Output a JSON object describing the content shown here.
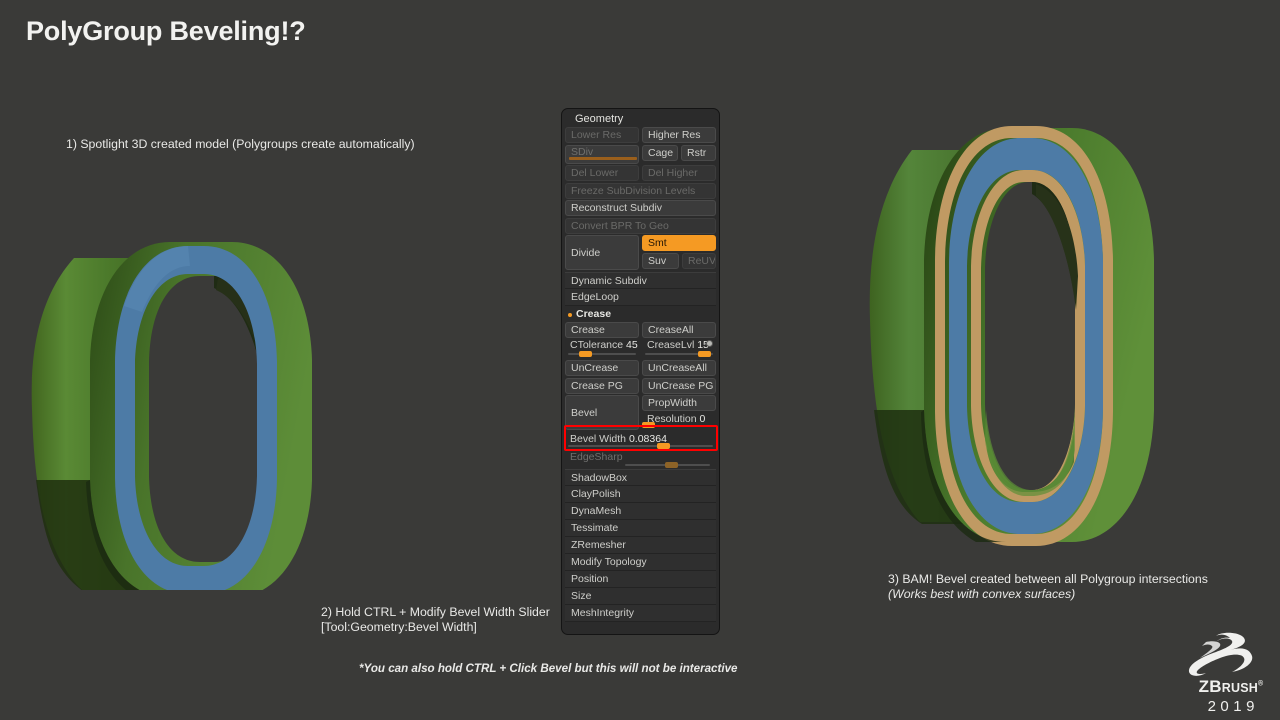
{
  "page": {
    "title": "PolyGroup Beveling!?",
    "background_color": "#3a3a38"
  },
  "annotations": {
    "step1": "1) Spotlight 3D created model (Polygroups create automatically)",
    "step2_line1": "2) Hold CTRL + Modify Bevel Width Slider",
    "step2_line2": "[Tool:Geometry:Bevel Width]",
    "step3_line1": "3) BAM! Bevel created between all Polygroup intersections",
    "step3_line2": "(Works best with convex surfaces)",
    "footnote": "*You can also hold CTRL + Click Bevel but this will not be interactive"
  },
  "logo": {
    "word_z": "Z",
    "word_b": "B",
    "word_rush": "RUSH",
    "trademark": "®",
    "year": "2019"
  },
  "models": {
    "left": {
      "name": "spotlight-3d-model-unbeveled",
      "outer_color": "#4d7ba6",
      "face_color": "#4f7a34",
      "face_color_dark": "#2e4d1f"
    },
    "right": {
      "name": "beveled-model",
      "outer_color": "#4d7ba6",
      "bevel_color": "#c09a63",
      "face_color": "#4f7a34",
      "face_color_dark": "#2e4d1f"
    }
  },
  "panel": {
    "title": "Geometry",
    "accent_color": "#f59a23",
    "rows": {
      "lower_res": "Lower Res",
      "higher_res": "Higher Res",
      "sdiv": {
        "label": "SDiv",
        "value": ""
      },
      "cage": "Cage",
      "rstr": "Rstr",
      "del_lower": "Del Lower",
      "del_higher": "Del Higher",
      "freeze_subdivision_levels": "Freeze SubDivision Levels",
      "reconstruct_subdiv": "Reconstruct Subdiv",
      "convert_bpr_to_geo": "Convert BPR To Geo",
      "divide": "Divide",
      "smt": "Smt",
      "suv": "Suv",
      "reuv": "ReUV",
      "dynamic_subdiv": "Dynamic Subdiv",
      "edgeloop": "EdgeLoop",
      "crease_section": "Crease",
      "crease": "Crease",
      "creaseall": "CreaseAll",
      "ctolerance": {
        "label": "CTolerance",
        "value": "45"
      },
      "creaselvl": {
        "label": "CreaseLvl",
        "value": "15"
      },
      "uncrease": "UnCrease",
      "uncreaseall": "UnCreaseAll",
      "crease_pg": "Crease PG",
      "uncrease_pg": "UnCrease PG",
      "bevel": "Bevel",
      "propwidth": "PropWidth",
      "resolution": {
        "label": "Resolution",
        "value": "0"
      },
      "bevel_width": {
        "label": "Bevel Width",
        "value": "0.08364"
      },
      "edgesharp": {
        "label": "EdgeSharp",
        "value": ""
      },
      "shadowbox": "ShadowBox",
      "claypolish": "ClayPolish",
      "dynamesh": "DynaMesh",
      "tessimate": "Tessimate",
      "zremesher": "ZRemesher",
      "modify_topology": "Modify Topology",
      "position": "Position",
      "size": "Size",
      "meshintegrity": "MeshIntegrity"
    },
    "highlight": {
      "target": "Bevel Width",
      "color": "#ff0000"
    }
  }
}
